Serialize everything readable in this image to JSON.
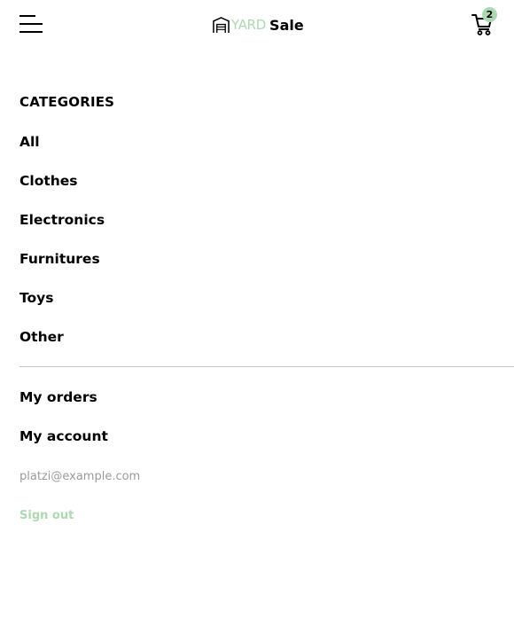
{
  "header": {
    "menu_icon": "hamburger-menu-icon",
    "logo_icon": "house-icon",
    "logo_brand": "YARD",
    "logo_word": "Sale",
    "cart_icon": "shopping-cart-icon",
    "cart_count": "2"
  },
  "menu": {
    "categories_title": "CATEGORIES",
    "categories": [
      "All",
      "Clothes",
      "Electronics",
      "Furnitures",
      "Toys",
      "Other"
    ],
    "my_orders": "My orders",
    "my_account": "My account",
    "email": "platzi@example.com",
    "sign_out": "Sign out"
  },
  "colors": {
    "accent": "#acd9b2",
    "muted_text": "#9a9a9a",
    "divider": "#c7c7c7"
  }
}
